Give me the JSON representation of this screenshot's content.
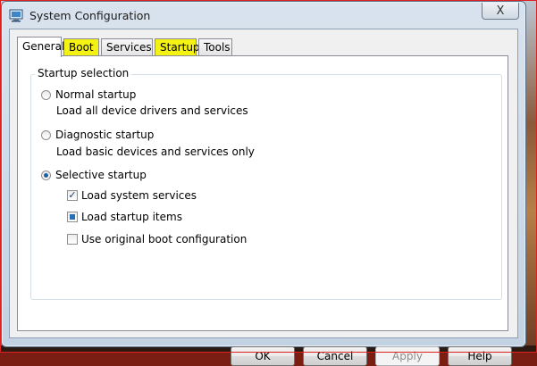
{
  "window": {
    "title": "System Configuration",
    "close_symbol": "X"
  },
  "tabs": [
    {
      "label": "General",
      "active": true
    },
    {
      "label": "Boot",
      "highlighted": true
    },
    {
      "label": "Services"
    },
    {
      "label": "Startup",
      "highlighted": true
    },
    {
      "label": "Tools"
    }
  ],
  "startup_selection": {
    "group_label": "Startup selection",
    "options": [
      {
        "label": "Normal startup",
        "description": "Load all device drivers and services",
        "selected": false
      },
      {
        "label": "Diagnostic startup",
        "description": "Load basic devices and services only",
        "selected": false
      },
      {
        "label": "Selective startup",
        "selected": true
      }
    ],
    "selective_items": [
      {
        "label": "Load system services",
        "state": "checked"
      },
      {
        "label": "Load startup items",
        "state": "indeterminate"
      },
      {
        "label": "Use original boot configuration",
        "state": "unchecked"
      }
    ]
  },
  "buttons": {
    "ok": "OK",
    "cancel": "Cancel",
    "apply": "Apply",
    "help": "Help"
  },
  "colors": {
    "highlight": "#f4f212",
    "radio_dot": "#1f5fa8"
  }
}
